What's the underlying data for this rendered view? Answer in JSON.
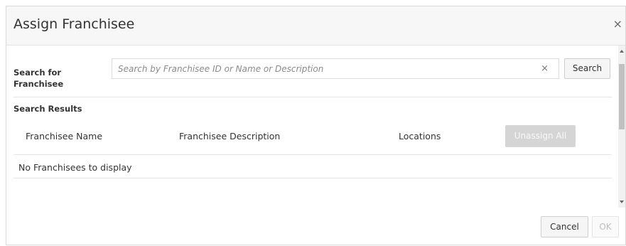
{
  "dialog": {
    "title": "Assign Franchisee",
    "close_icon": "close-icon"
  },
  "search": {
    "label": "Search for Franchisee",
    "placeholder": "Search by Franchisee ID or Name or Description",
    "value": "",
    "clear_icon": "close-icon",
    "button_label": "Search"
  },
  "results": {
    "label": "Search Results",
    "columns": [
      "Franchisee Name",
      "Franchisee Description",
      "Locations"
    ],
    "unassign_all_label": "Unassign All",
    "empty_message": "No Franchisees to display"
  },
  "footer": {
    "cancel_label": "Cancel",
    "ok_label": "OK"
  }
}
